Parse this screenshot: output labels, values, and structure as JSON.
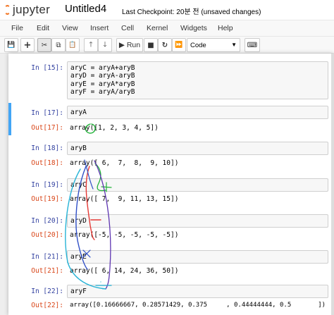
{
  "header": {
    "logo_text": "jupyter",
    "notebook_title": "Untitled4",
    "checkpoint_text": "Last Checkpoint: 20분 전  (unsaved changes)"
  },
  "menu": [
    "File",
    "Edit",
    "View",
    "Insert",
    "Cell",
    "Kernel",
    "Widgets",
    "Help"
  ],
  "toolbar": {
    "save_icon": "💾",
    "add_icon": "+",
    "cut_icon": "✂",
    "copy_icon": "⧉",
    "paste_icon": "📋",
    "up_icon": "🡑",
    "down_icon": "🡓",
    "run_label": "▶ Run",
    "stop_icon": "■",
    "restart_icon": "↻",
    "fastforward_icon": "⏩",
    "cell_type": "Code",
    "keyboard_icon": "⌨"
  },
  "cells": [
    {
      "in_prompt": "In [15]:",
      "code": "aryC = aryA+aryB\naryD = aryA-aryB\naryE = aryA*aryB\naryF = aryA/aryB",
      "out_prompt": "",
      "output": ""
    },
    {
      "in_prompt": "In [17]:",
      "code": "aryA",
      "out_prompt": "Out[17]:",
      "output": "array([1, 2, 3, 4, 5])"
    },
    {
      "in_prompt": "In [18]:",
      "code": "aryB",
      "out_prompt": "Out[18]:",
      "output": "array([ 6,  7,  8,  9, 10])"
    },
    {
      "in_prompt": "In [19]:",
      "code": "aryC",
      "out_prompt": "Out[19]:",
      "output": "array([ 7,  9, 11, 13, 15])"
    },
    {
      "in_prompt": "In [20]:",
      "code": "aryD",
      "out_prompt": "Out[20]:",
      "output": "array([-5, -5, -5, -5, -5])"
    },
    {
      "in_prompt": "In [21]:",
      "code": "aryE",
      "out_prompt": "Out[21]:",
      "output": "array([ 6, 14, 24, 36, 50])"
    },
    {
      "in_prompt": "In [22]:",
      "code": "aryF",
      "out_prompt": "Out[22]:",
      "output": "array([0.16666667, 0.28571429, 0.375     , 0.44444444, 0.5       ])"
    }
  ],
  "colors": {
    "in_prompt": "#303f9f",
    "out_prompt": "#d84315",
    "selected_bar": "#42a5f5",
    "annotation_blue": "#2f4fc6",
    "annotation_cyan": "#27b3d6",
    "annotation_red": "#e53935",
    "annotation_green": "#22b33a"
  }
}
